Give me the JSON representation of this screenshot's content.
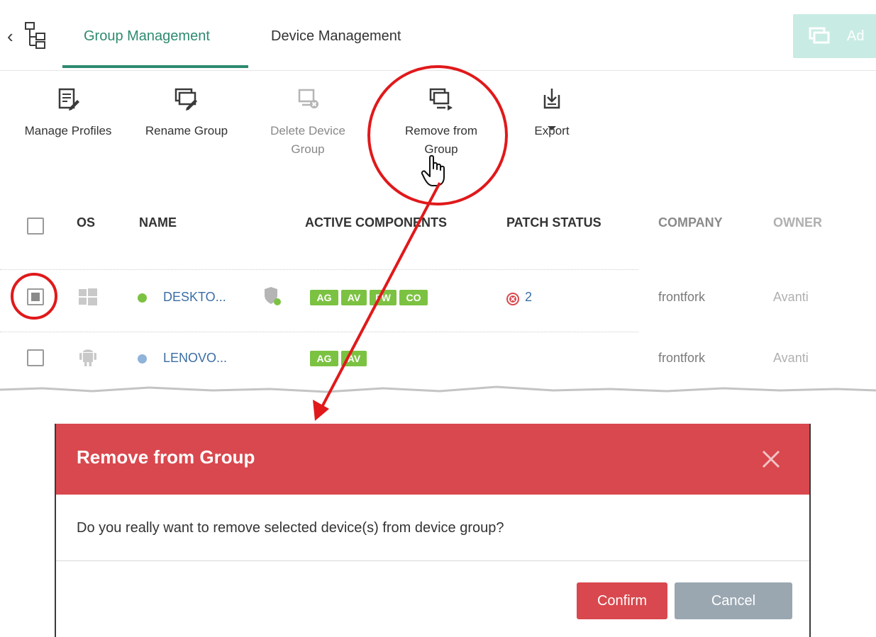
{
  "tabs": {
    "group_management": "Group Management",
    "device_management": "Device Management",
    "add_label": "Ad"
  },
  "toolbar": {
    "manage_profiles": [
      "Manage Profiles"
    ],
    "rename_group": [
      "Rename Group"
    ],
    "delete_device_group": [
      "Delete Device",
      "Group"
    ],
    "remove_from_group": [
      "Remove from",
      "Group"
    ],
    "export": [
      "Export"
    ]
  },
  "table": {
    "headers": {
      "os": "OS",
      "name": "NAME",
      "active_components": "ACTIVE COMPONENTS",
      "patch_status": "PATCH STATUS",
      "company": "COMPANY",
      "owner": "OWNER"
    },
    "rows": [
      {
        "selected": true,
        "os": "windows",
        "status_color": "#7cc242",
        "name": "DESKTO...",
        "components": [
          "AG",
          "AV",
          "FW",
          "CO"
        ],
        "patch_count": "2",
        "company": "frontfork",
        "owner": "Avanti"
      },
      {
        "selected": false,
        "os": "android",
        "status_color": "#8fb3d9",
        "name": "LENOVO...",
        "components": [
          "AG",
          "AV"
        ],
        "patch_count": "",
        "company": "frontfork",
        "owner": "Avanti"
      }
    ]
  },
  "dialog": {
    "title": "Remove from Group",
    "message": "Do you really want to remove selected device(s) from device group?",
    "confirm": "Confirm",
    "cancel": "Cancel"
  },
  "colors": {
    "accent": "#2e8b6f",
    "dialog_header": "#d9484e",
    "annotation": "#e0191b",
    "badge": "#7cc242"
  }
}
